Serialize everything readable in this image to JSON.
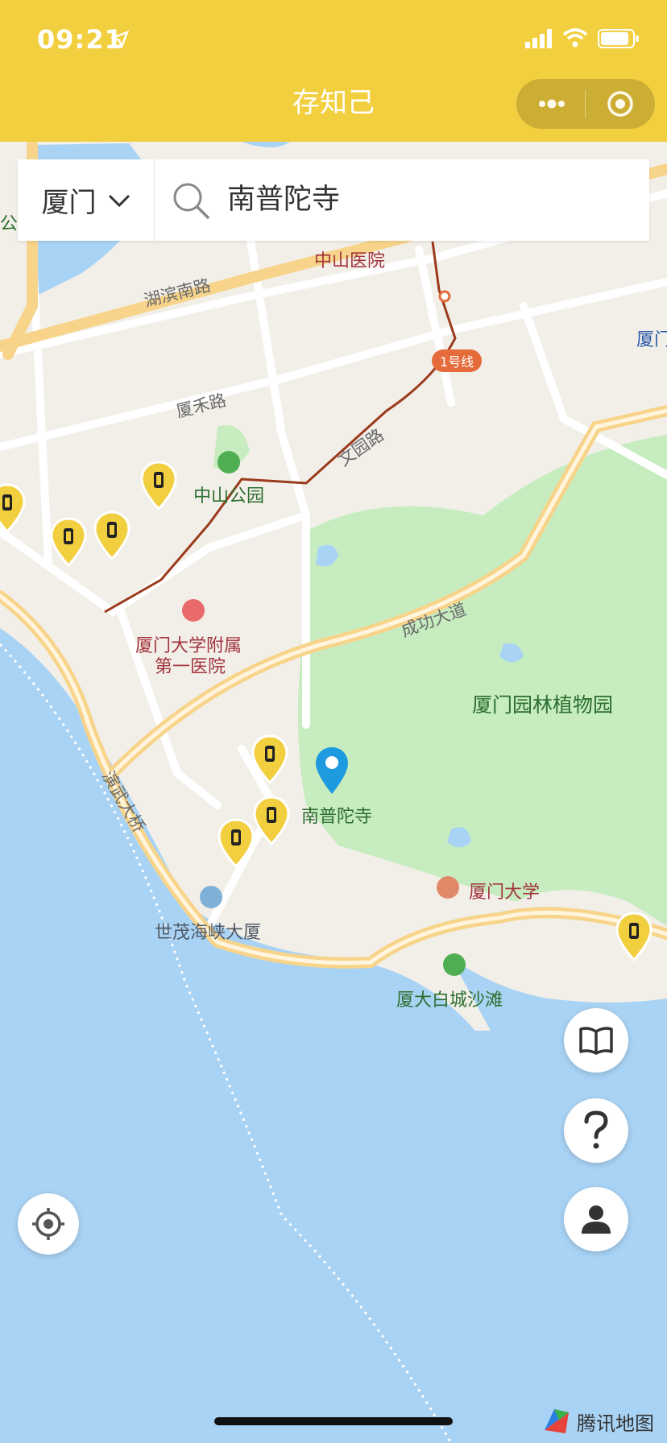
{
  "status_bar": {
    "time": "09:21"
  },
  "app": {
    "title": "存知己"
  },
  "search": {
    "city": "厦门",
    "query": "南普陀寺"
  },
  "map": {
    "labels": {
      "zhongshan_hospital": "中山医院",
      "hubin_south_road": "湖滨南路",
      "metro_line": "1号线",
      "xiahe_road": "厦禾路",
      "wenyuan_road": "文园路",
      "zhongshan_park": "中山公园",
      "xmu_hospital_line1": "厦门大学附属",
      "xmu_hospital_line2": "第一医院",
      "chenggong_avenue": "成功大道",
      "botanical_garden": "厦门园林植物园",
      "nanputuo": "南普陀寺",
      "yanwu_bridge": "演武大桥",
      "xmu": "厦门大学",
      "shimao": "世茂海峡大厦",
      "baicheng_beach": "厦大白城沙滩",
      "edge_left": "公园",
      "edge_right": "厦门"
    },
    "attribution": "腾讯地图"
  },
  "colors": {
    "brand_yellow": "#f2cf3f",
    "water": "#a9d3f5",
    "green": "#c6ecc0",
    "marker_blue": "#1e9be0"
  },
  "icons": {
    "search": "search-icon",
    "locate": "locate-icon",
    "guide": "book-icon",
    "help": "question-icon",
    "profile": "person-icon",
    "locker": "luggage-locker-icon"
  }
}
